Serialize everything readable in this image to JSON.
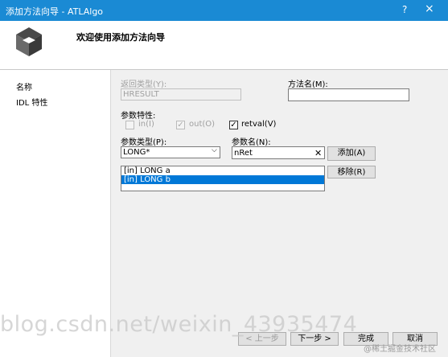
{
  "window": {
    "title": "添加方法向导 - ATLAlgo",
    "help": "?",
    "close": "×"
  },
  "header": {
    "heading": "欢迎使用添加方法向导"
  },
  "sidebar": {
    "items": [
      {
        "label": "名称"
      },
      {
        "label": "IDL 特性"
      }
    ]
  },
  "form": {
    "return_type_label": "返回类型(Y):",
    "return_type_value": "HRESULT",
    "method_name_label": "方法名(M):",
    "method_name_value": "",
    "param_attr_label": "参数特性:",
    "in_label": "in(I)",
    "out_label": "out(O)",
    "retval_label": "retval(V)",
    "param_type_label": "参数类型(P):",
    "param_type_value": "LONG*",
    "param_name_label": "参数名(N):",
    "param_name_value": "nRet",
    "add_label": "添加(A)",
    "remove_label": "移除(R)",
    "params": [
      {
        "text": "[in] LONG a"
      },
      {
        "text": "[in] LONG b"
      }
    ]
  },
  "footer": {
    "prev_label": "< 上一步",
    "next_label": "下一步 >",
    "finish_label": "完成",
    "cancel_label": "取消"
  },
  "overlay": {
    "watermark": "blog.csdn.net/weixin_43935474",
    "brand": "@稀土掘金技术社区"
  },
  "icons": {
    "clear": "✕",
    "dropdown": "⌵",
    "check": "✓"
  }
}
